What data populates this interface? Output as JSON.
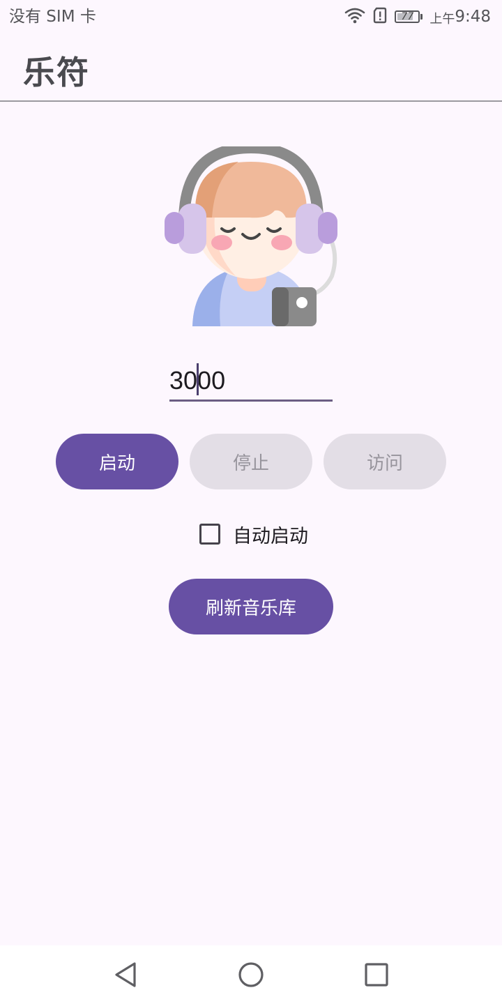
{
  "status_bar": {
    "carrier": "没有 SIM 卡",
    "battery_level": "77",
    "battery_fraction": 0.77,
    "time_prefix": "上午",
    "time": "9:48",
    "icons": [
      "wifi-icon",
      "sim-alert-icon",
      "battery-icon"
    ]
  },
  "app_bar": {
    "title": "乐符"
  },
  "avatar": {
    "icon": "headphones-avatar-icon"
  },
  "port_input": {
    "value": "3000"
  },
  "buttons": {
    "start": "启动",
    "stop": "停止",
    "visit": "访问",
    "refresh": "刷新音乐库"
  },
  "auto_start": {
    "label": "自动启动",
    "checked": false
  },
  "nav_bar": {
    "icons": [
      "back-icon",
      "home-icon",
      "recents-icon"
    ]
  },
  "colors": {
    "background": "#fdf7fe",
    "primary": "#6750a4",
    "disabled_button": "#e3dee6",
    "disabled_text": "#97949c"
  }
}
